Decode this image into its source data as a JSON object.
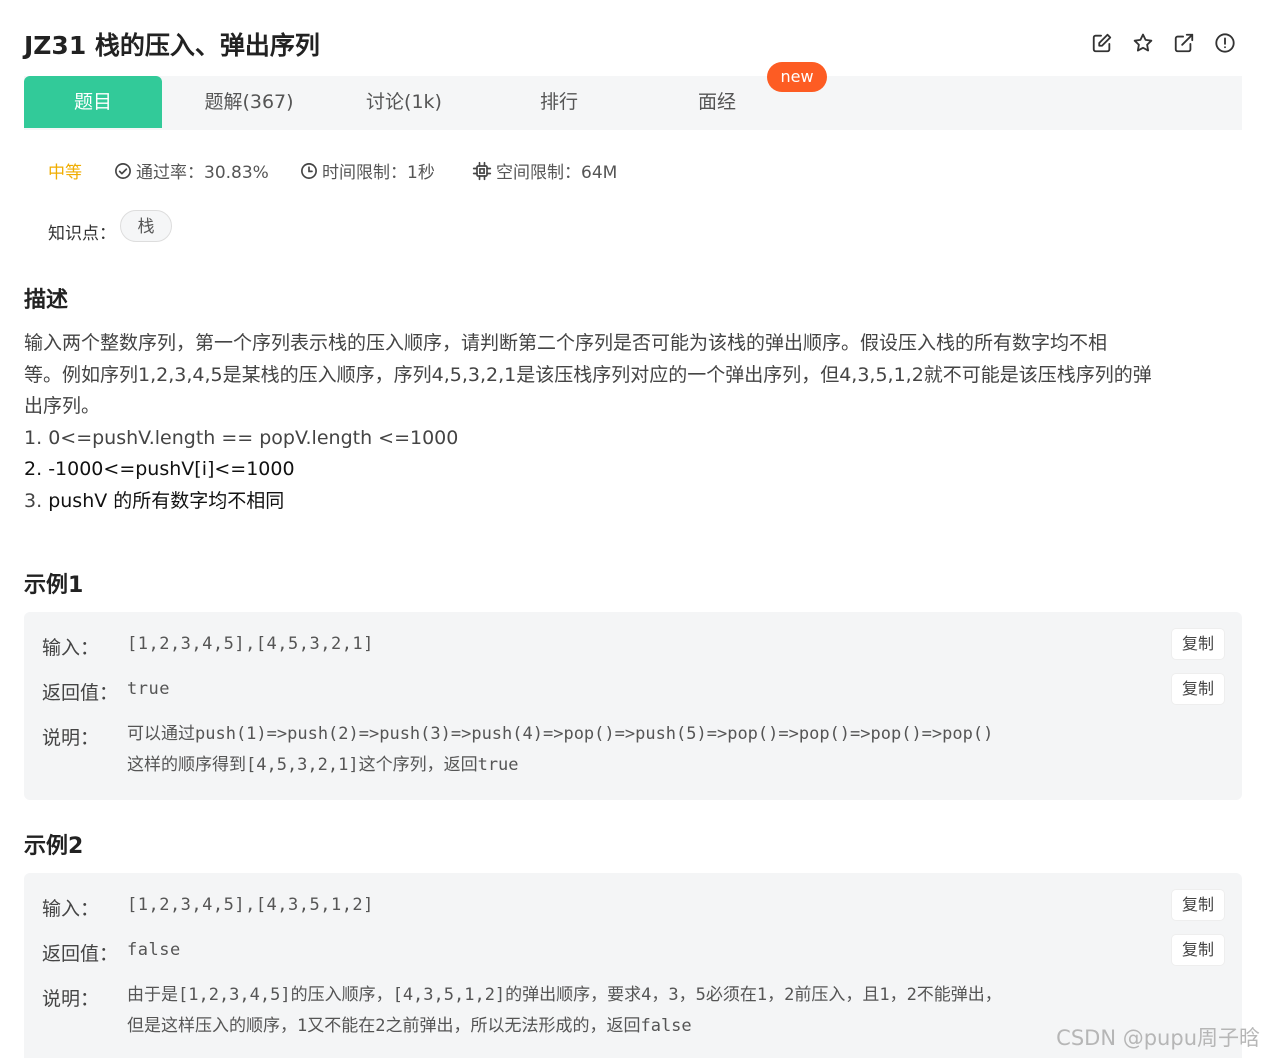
{
  "header": {
    "title": "JZ31  栈的压入、弹出序列",
    "icons": [
      "edit-icon",
      "star-icon",
      "external-link-icon",
      "alert-icon"
    ]
  },
  "tabs": [
    {
      "label": "题目",
      "active": true
    },
    {
      "label": "题解(367)",
      "active": false
    },
    {
      "label": "讨论(1k)",
      "active": false
    },
    {
      "label": "排行",
      "active": false
    },
    {
      "label": "面经",
      "active": false
    }
  ],
  "new_badge": "new",
  "meta": {
    "difficulty": "中等",
    "pass_rate": "通过率：30.83%",
    "time_limit": "时间限制：1秒",
    "space_limit": "空间限制：64M"
  },
  "knowledge": {
    "label": "知识点：",
    "tag": "栈"
  },
  "description": {
    "heading": "描述",
    "lines": [
      "输入两个整数序列，第一个序列表示栈的压入顺序，请判断第二个序列是否可能为该栈的弹出顺序。假设压入栈的所有数字均不相",
      "等。例如序列1,2,3,4,5是某栈的压入顺序，序列4,5,3,2,1是该压栈序列对应的一个弹出序列，但4,3,5,1,2就不可能是该压栈序列的弹",
      "出序列。"
    ],
    "constraints": [
      {
        "num": "1.",
        "text": "0<=pushV.length == popV.length <=1000"
      },
      {
        "num": "2.",
        "text": "-1000<=pushV[i]<=1000"
      },
      {
        "num": "3.",
        "text": "pushV 的所有数字均不相同"
      }
    ]
  },
  "examples": [
    {
      "heading": "示例1",
      "input_label": "输入：",
      "input": "[1,2,3,4,5],[4,5,3,2,1]",
      "output_label": "返回值：",
      "output": "true",
      "note_label": "说明：",
      "note_lines": [
        "可以通过push(1)=>push(2)=>push(3)=>push(4)=>pop()=>push(5)=>pop()=>pop()=>pop()=>pop()",
        "这样的顺序得到[4,5,3,2,1]这个序列，返回true"
      ],
      "copy_label": "复制"
    },
    {
      "heading": "示例2",
      "input_label": "输入：",
      "input": "[1,2,3,4,5],[4,3,5,1,2]",
      "output_label": "返回值：",
      "output": "false",
      "note_label": "说明：",
      "note_lines": [
        "由于是[1,2,3,4,5]的压入顺序，[4,3,5,1,2]的弹出顺序，要求4，3，5必须在1，2前压入，且1，2不能弹出，",
        "但是这样压入的顺序，1又不能在2之前弹出，所以无法形成的，返回false"
      ],
      "copy_label": "复制"
    }
  ],
  "watermark": "CSDN @pupu周子晗",
  "colors": {
    "accent": "#32ca99",
    "badge": "#fd5c23",
    "difficulty": "#f0ad00"
  }
}
